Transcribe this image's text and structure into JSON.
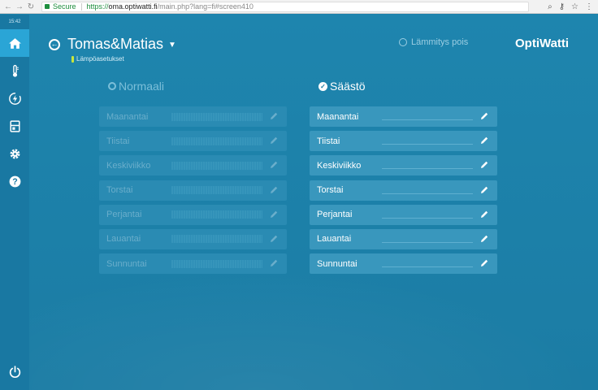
{
  "browser": {
    "secure_label": "Secure",
    "url_proto": "https://",
    "url_host": "oma.optiwatti.fi",
    "url_rest": "/main.php?lang=fi#screen410"
  },
  "sidebar": {
    "clock": "15:42",
    "items": [
      {
        "icon": "home-icon",
        "active": true
      },
      {
        "icon": "thermometer-icon",
        "active": false
      },
      {
        "icon": "energy-icon",
        "active": false
      },
      {
        "icon": "device-icon",
        "active": false
      },
      {
        "icon": "gear-icon",
        "active": false
      },
      {
        "icon": "help-icon",
        "active": false
      }
    ],
    "power_icon": "power-icon"
  },
  "header": {
    "title": "Tomas&Matias",
    "subtitle": "Lämpöasetukset",
    "status": "Lämmitys pois",
    "logo": "OptiWatti"
  },
  "modes": {
    "normal": {
      "title": "Normaali",
      "selected": false,
      "days": [
        "Maanantai",
        "Tiistai",
        "Keskiviikko",
        "Torstai",
        "Perjantai",
        "Lauantai",
        "Sunnuntai"
      ]
    },
    "saving": {
      "title": "Säästö",
      "selected": true,
      "days": [
        "Maanantai",
        "Tiistai",
        "Keskiviikko",
        "Torstai",
        "Perjantai",
        "Lauantai",
        "Sunnuntai"
      ]
    }
  },
  "colors": {
    "background": "#1d82ab",
    "sidebar": "#1978a2",
    "active_nav": "#2aa5d6",
    "accent_green": "#c8e63c"
  }
}
